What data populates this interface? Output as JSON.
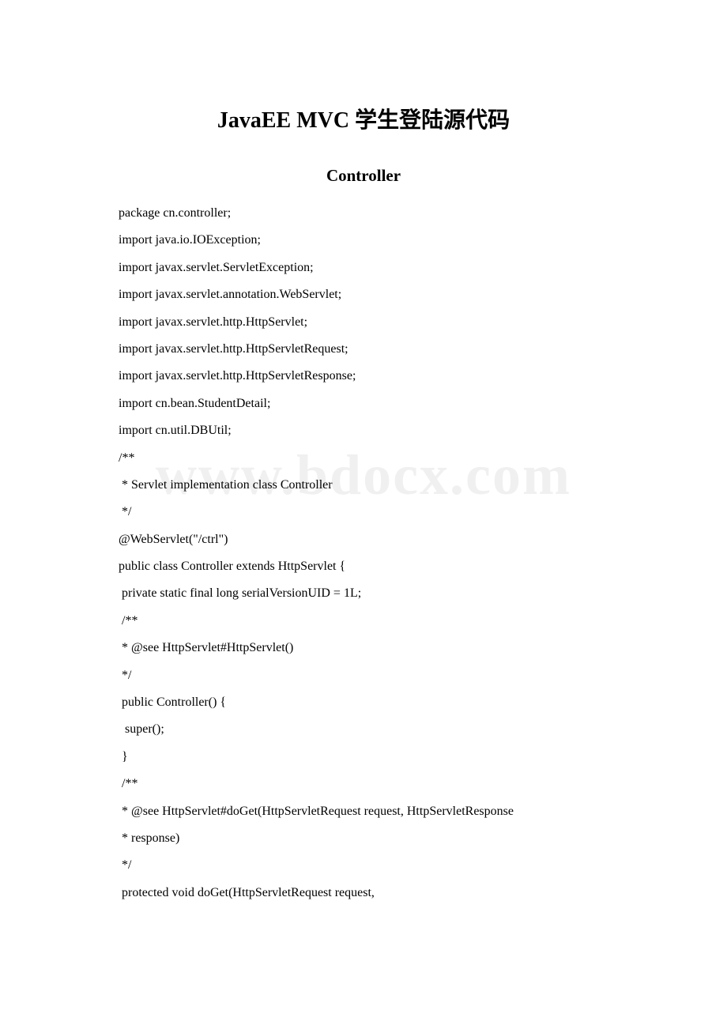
{
  "watermark": "www.bdocx.com",
  "title": "JavaEE MVC 学生登陆源代码",
  "subtitle": "Controller",
  "code_lines": [
    "package cn.controller;",
    "import java.io.IOException;",
    "import javax.servlet.ServletException;",
    "import javax.servlet.annotation.WebServlet;",
    "import javax.servlet.http.HttpServlet;",
    "import javax.servlet.http.HttpServletRequest;",
    "import javax.servlet.http.HttpServletResponse;",
    "import cn.bean.StudentDetail;",
    "import cn.util.DBUtil;",
    "/**",
    " * Servlet implementation class Controller",
    " */",
    "@WebServlet(\"/ctrl\")",
    "public class Controller extends HttpServlet {",
    " private static final long serialVersionUID = 1L;",
    " /**",
    " * @see HttpServlet#HttpServlet()",
    " */",
    " public Controller() {",
    "  super();",
    " }",
    " /**",
    " * @see HttpServlet#doGet(HttpServletRequest request, HttpServletResponse",
    " * response)",
    " */",
    " protected void doGet(HttpServletRequest request,"
  ]
}
